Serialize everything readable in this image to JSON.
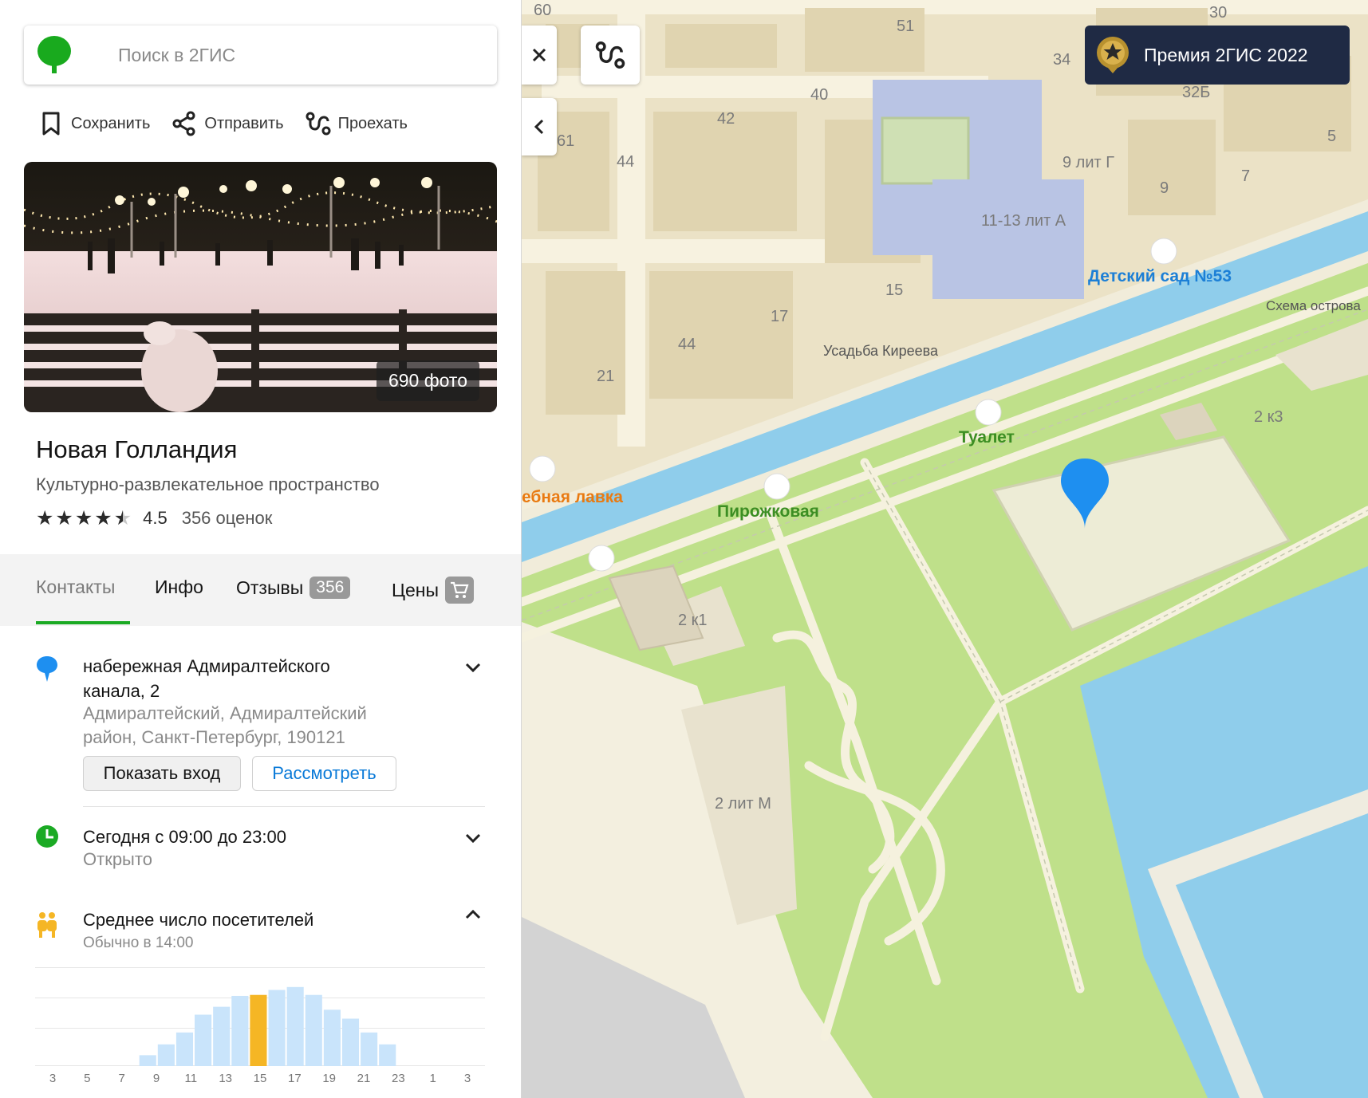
{
  "search": {
    "placeholder": "Поиск в 2ГИС"
  },
  "actions": {
    "save": "Сохранить",
    "share": "Отправить",
    "route": "Проехать"
  },
  "photo": {
    "count_label": "690 фото"
  },
  "place": {
    "title": "Новая Голландия",
    "category": "Культурно-развлекательное пространство",
    "rating": "4.5",
    "rating_count": "356 оценок",
    "stars_filled": 4.5
  },
  "tabs": {
    "contacts": "Контакты",
    "info": "Инфо",
    "reviews": "Отзывы",
    "reviews_count": "356",
    "prices": "Цены"
  },
  "address": {
    "line1": "набережная Адмиралтейского",
    "line2": "канала, 2",
    "district1": "Адмиралтейский, Адмиралтейский",
    "district2": "район, Санкт-Петербург, 190121",
    "entrance_button": "Показать вход",
    "view_button": "Рассмотреть"
  },
  "hours": {
    "today": "Сегодня с 09:00 до 23:00",
    "status": "Открыто"
  },
  "visitors": {
    "title": "Среднее число посетителей",
    "subtitle": "Обычно в 14:00",
    "hours": [
      "3",
      "5",
      "7",
      "9",
      "11",
      "13",
      "15",
      "17",
      "19",
      "21",
      "23",
      "1",
      "3"
    ],
    "levels": [
      0,
      0,
      0,
      0,
      0,
      0,
      0.11,
      0.22,
      0.34,
      0.52,
      0.6,
      0.71,
      0.72,
      0.77,
      0.8,
      0.72,
      0.57,
      0.48,
      0.34,
      0.22,
      0,
      0,
      0,
      0,
      0,
      0
    ],
    "highlight_index": 12,
    "colors": {
      "bar": "#c9e4fb",
      "highlight": "#f5b625"
    }
  },
  "map": {
    "award": "Премия 2ГИС 2022",
    "numbers": [
      "60",
      "51",
      "30",
      "34",
      "40",
      "42",
      "32Б",
      "5",
      "61",
      "44",
      "9 лит Г",
      "9",
      "7",
      "11-13 лит А",
      "15",
      "17",
      "44",
      "21",
      "2 к3",
      "2 к1",
      "2 лит М"
    ],
    "pois": {
      "kindergarten": "Детский сад №53",
      "island_map": "Схема острова",
      "estate": "Усадьба Киреева",
      "toilet": "Туалет",
      "bakery": "Пирожковая",
      "fish_shop": "ебная лавка"
    },
    "colors": {
      "water": "#8fcdeb",
      "park": "#bfe08a",
      "building": "#ece4c9",
      "road": "#f7f2e0"
    }
  }
}
